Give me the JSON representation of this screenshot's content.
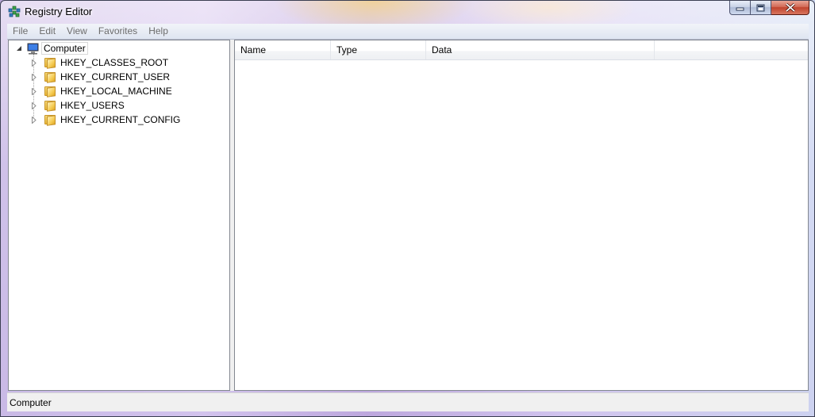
{
  "window": {
    "title": "Registry Editor",
    "icon": "registry-editor-icon"
  },
  "menu": [
    "File",
    "Edit",
    "View",
    "Favorites",
    "Help"
  ],
  "tree": {
    "root": "Computer",
    "root_icon": "computer-icon",
    "hives": [
      "HKEY_CLASSES_ROOT",
      "HKEY_CURRENT_USER",
      "HKEY_LOCAL_MACHINE",
      "HKEY_USERS",
      "HKEY_CURRENT_CONFIG"
    ]
  },
  "list": {
    "columns": [
      "Name",
      "Type",
      "Data"
    ],
    "rows": []
  },
  "status": {
    "path": "Computer"
  },
  "colors": {
    "close_button": "#c0432d",
    "pane_border": "#828790",
    "menu_text": "#6d6d6d"
  }
}
